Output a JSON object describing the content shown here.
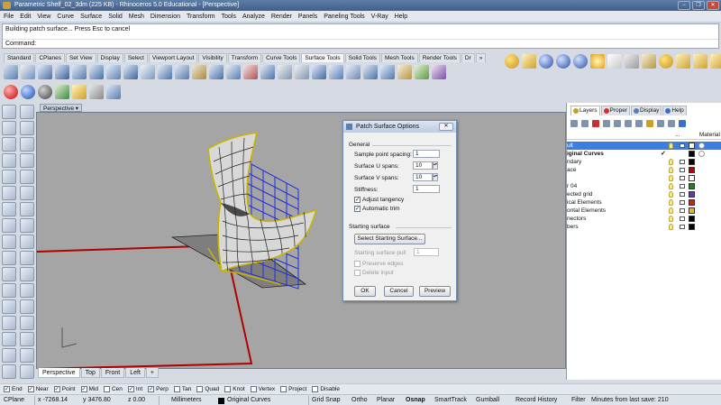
{
  "window": {
    "title": "Parametric Shelf_02_3dm (225 KB) - Rhinoceros 5.0 Educational - [Perspective]",
    "buttons": [
      "–",
      "❐",
      "✕"
    ]
  },
  "menu": [
    "File",
    "Edit",
    "View",
    "Curve",
    "Surface",
    "Solid",
    "Mesh",
    "Dimension",
    "Transform",
    "Tools",
    "Analyze",
    "Render",
    "Panels",
    "Paneling Tools",
    "V-Ray",
    "Help"
  ],
  "command": {
    "history": "Building patch surface... Press Esc to cancel",
    "prompt": "Command:"
  },
  "toolbar_tabs": [
    "Standard",
    "CPlanes",
    "Set View",
    "Display",
    "Select",
    "Viewport Layout",
    "Visibility",
    "Transform",
    "Curve Tools",
    "Surface Tools",
    "Solid Tools",
    "Mesh Tools",
    "Render Tools",
    "Dr",
    "»"
  ],
  "toolbar_tabs_active": "Surface Tools",
  "viewport": {
    "label": "Perspective",
    "tabs": [
      "Perspective",
      "Top",
      "Front",
      "Left",
      "+"
    ],
    "active_tab": "Perspective"
  },
  "dialog": {
    "title": "Patch Surface Options",
    "close": "✕",
    "general_label": "General",
    "fields": [
      {
        "label": "Sample point spacing:",
        "value": "1"
      },
      {
        "label": "Surface U spans:",
        "value": "10"
      },
      {
        "label": "Surface V spans:",
        "value": "10"
      },
      {
        "label": "Stiffness:",
        "value": "1"
      }
    ],
    "checkboxes": [
      {
        "label": "Adjust tangency",
        "checked": true
      },
      {
        "label": "Automatic trim",
        "checked": true
      }
    ],
    "starting_label": "Starting surface",
    "select_button": "Select Starting Surface...",
    "pull_label": "Starting surface pull",
    "pull_value": "1",
    "disabled_checks": [
      {
        "label": "Preserve edges"
      },
      {
        "label": "Delete input"
      }
    ],
    "buttons": {
      "ok": "OK",
      "cancel": "Cancel",
      "preview": "Preview"
    }
  },
  "right_panel": {
    "tabs": [
      "Layers",
      "Proper",
      "Display",
      "Help"
    ],
    "active_tab": "Layers",
    "header_dots": "...",
    "material_header": "Material",
    "layers": [
      {
        "name": "ult",
        "color": "#ffffff",
        "selected": true
      },
      {
        "name": "iginal Curves",
        "color": "#000000",
        "check": true,
        "bold": true
      },
      {
        "name": "ndary",
        "color": "#000000"
      },
      {
        "name": "ace",
        "color": "#c00000"
      },
      {
        "name": "",
        "color": "#ffffff"
      },
      {
        "name": "r 04",
        "color": "#208020"
      },
      {
        "name": "ected grid",
        "color": "#6a30c0"
      },
      {
        "name": "ical Elements",
        "color": "#d02020"
      },
      {
        "name": "ontal Elements",
        "color": "#e0c000"
      },
      {
        "name": "nectors",
        "color": "#000000"
      },
      {
        "name": "bers",
        "color": "#000000"
      }
    ]
  },
  "osnap": [
    {
      "label": "End",
      "checked": true
    },
    {
      "label": "Near",
      "checked": true
    },
    {
      "label": "Point",
      "checked": true
    },
    {
      "label": "Mid",
      "checked": true
    },
    {
      "label": "Cen",
      "checked": false
    },
    {
      "label": "Int",
      "checked": true
    },
    {
      "label": "Perp",
      "checked": true
    },
    {
      "label": "Tan",
      "checked": false
    },
    {
      "label": "Quad",
      "checked": false
    },
    {
      "label": "Knot",
      "checked": false
    },
    {
      "label": "Vertex",
      "checked": false
    },
    {
      "label": "Project",
      "checked": false
    },
    {
      "label": "Disable",
      "checked": false
    }
  ],
  "status": {
    "cplane": "CPlane",
    "x": "x -7268.14",
    "y": "y 3476.80",
    "z": "z 0.00",
    "units": "Millimeters",
    "layer": "Original Curves",
    "grid_snap": "Grid Snap",
    "ortho": "Ortho",
    "planar": "Planar",
    "osnap": "Osnap",
    "smarttrack": "SmartTrack",
    "gumball": "Gumball",
    "record_history": "Record History",
    "filter": "Filter",
    "last_save": "Minutes from last save: 210"
  },
  "colors": {
    "viewport_bg": "#a5a5a5",
    "selection": "#3d7fe0",
    "surface_edge": "#c8b400",
    "grid_blue": "#1f2fe0",
    "boundary_red": "#b00000"
  }
}
